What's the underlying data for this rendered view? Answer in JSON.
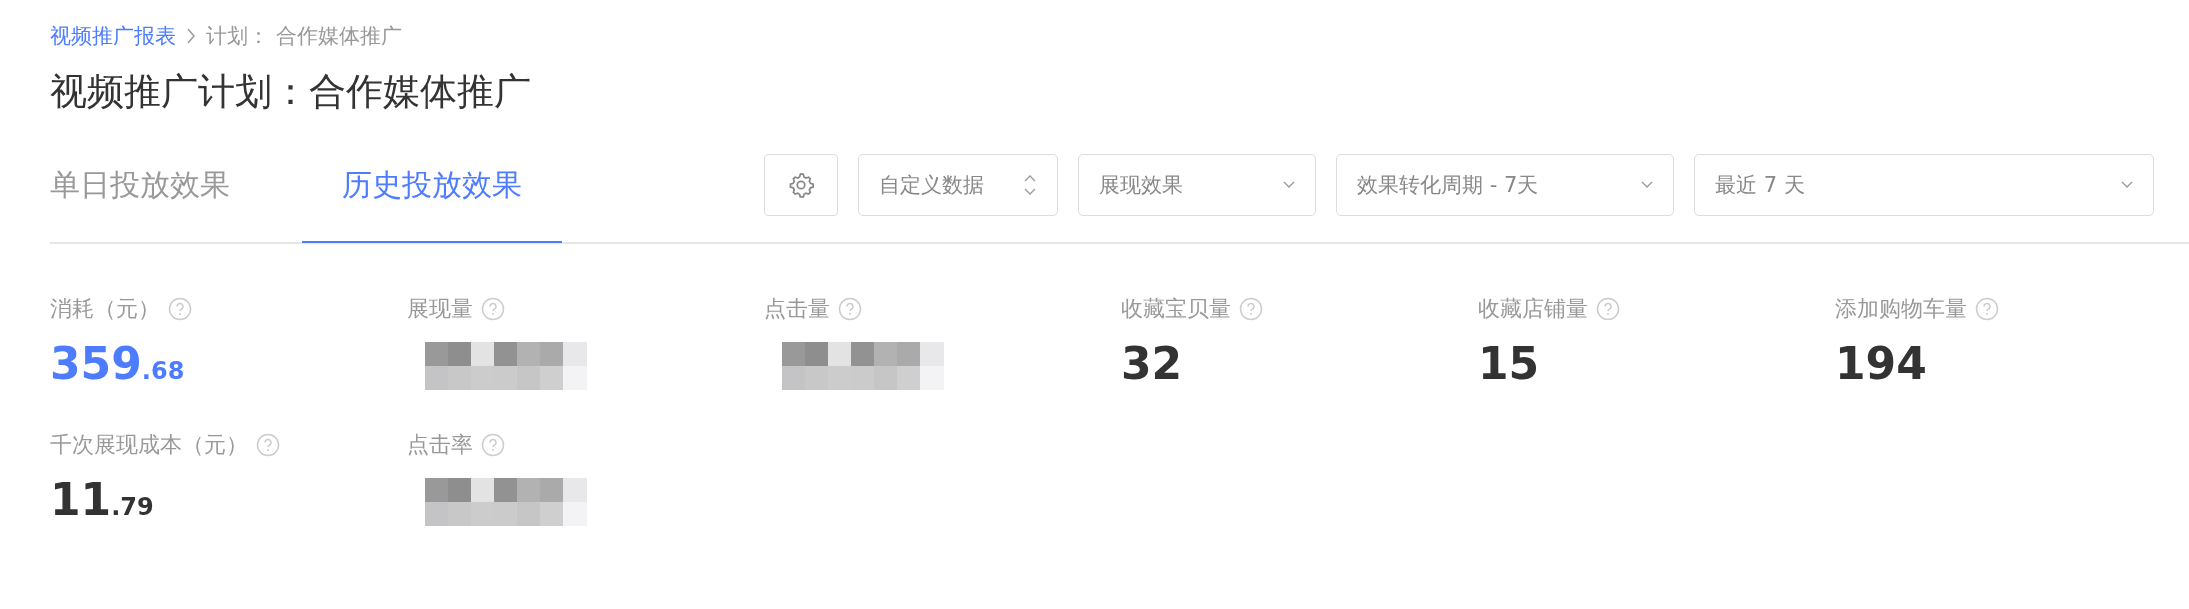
{
  "breadcrumb": [
    {
      "label": "视频推广报表",
      "link": true
    },
    {
      "label": "计划： 合作媒体推广",
      "link": false
    }
  ],
  "title": "视频推广计划：合作媒体推广",
  "tabs": [
    {
      "label": "单日投放效果",
      "selected": false
    },
    {
      "label": "历史投放效果",
      "selected": true
    }
  ],
  "toolbar": {
    "selects": [
      {
        "kind": "stepper",
        "value": "自定义数据"
      },
      {
        "kind": "dropdown",
        "value": "展现效果"
      },
      {
        "kind": "dropdown",
        "value": "效果转化周期 - 7天"
      },
      {
        "kind": "dropdown",
        "value": "最近 7 天"
      }
    ]
  },
  "metrics": [
    [
      {
        "label": "消耗（元）",
        "kind": "value",
        "integer": "359",
        "fraction": ".68",
        "highlight": true
      },
      {
        "label": "展现量",
        "kind": "blurred"
      },
      {
        "label": "点击量",
        "kind": "blurred"
      },
      {
        "label": "收藏宝贝量",
        "kind": "value",
        "integer": "32",
        "highlight": false
      },
      {
        "label": "收藏店铺量",
        "kind": "value",
        "integer": "15",
        "highlight": false
      },
      {
        "label": "添加购物车量",
        "kind": "value",
        "integer": "194",
        "highlight": false
      }
    ],
    [
      {
        "label": "千次展现成本（元）",
        "kind": "value",
        "integer": "11",
        "fraction": ".79",
        "highlight": false
      },
      {
        "label": "点击率",
        "kind": "blurred"
      }
    ]
  ]
}
